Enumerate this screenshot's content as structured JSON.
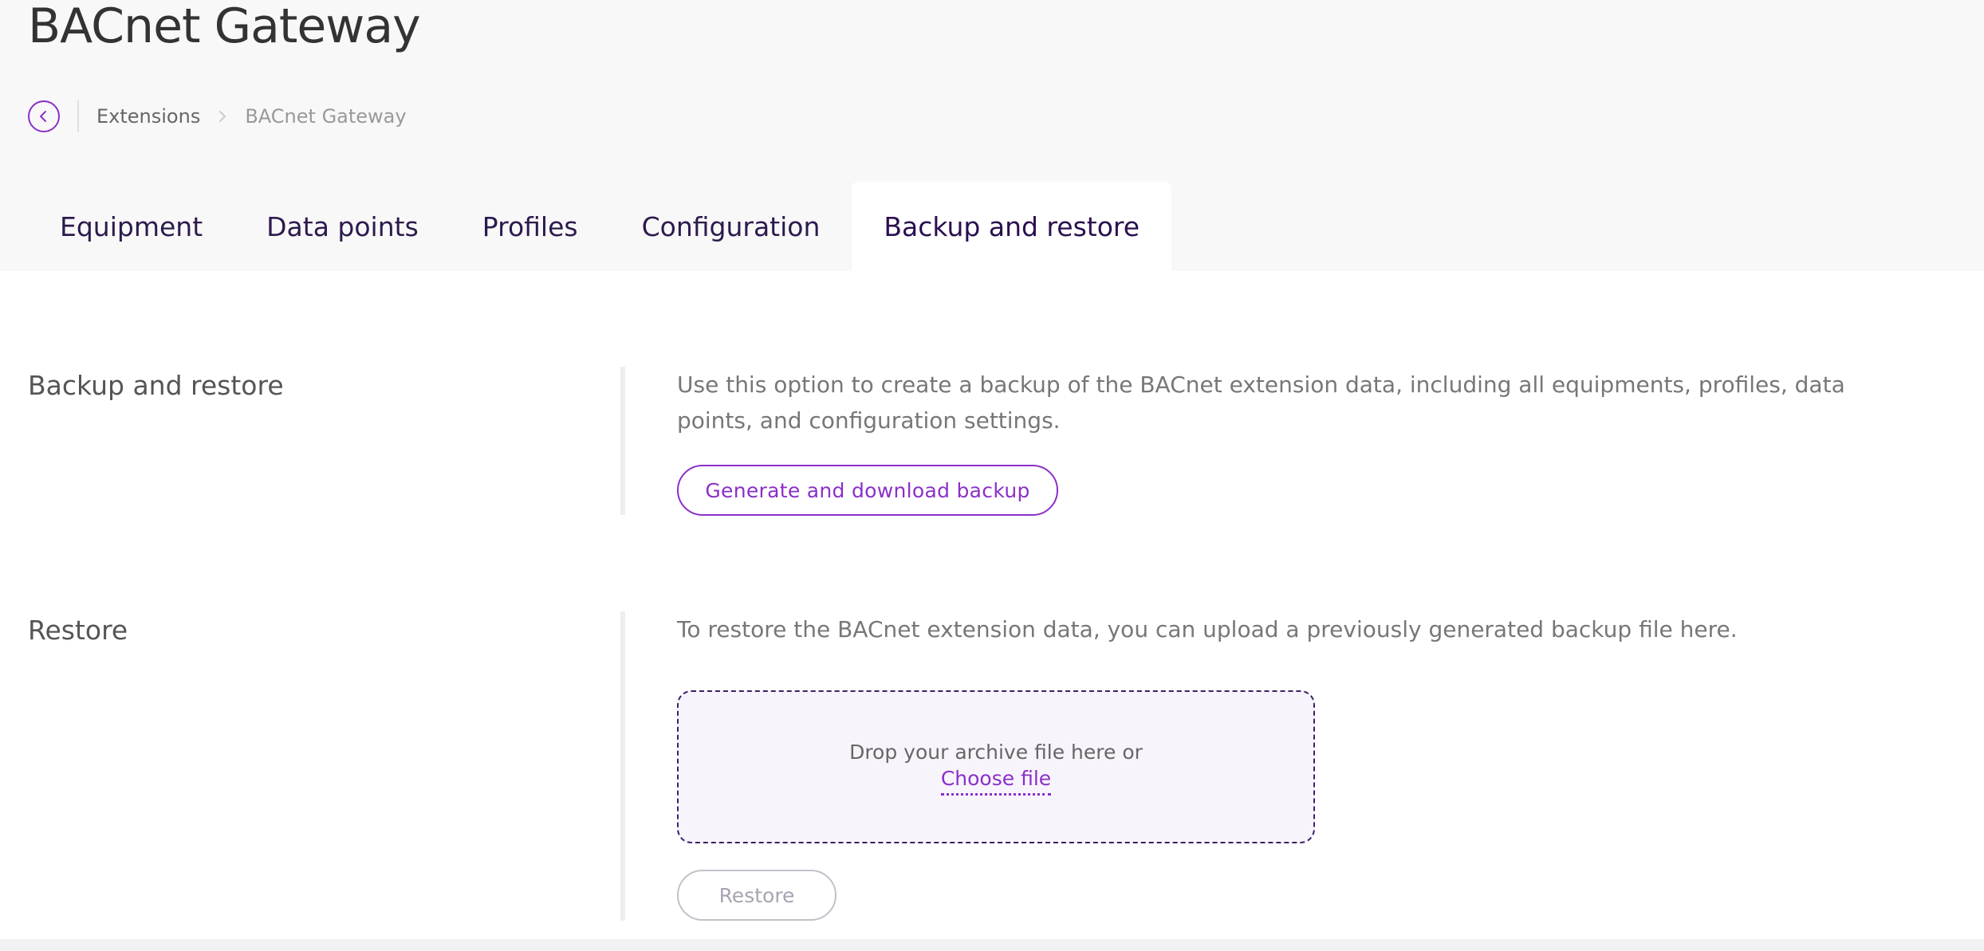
{
  "page": {
    "title": "BACnet Gateway"
  },
  "breadcrumb": {
    "back_icon": "chevron-left-icon",
    "items": [
      "Extensions",
      "BACnet Gateway"
    ]
  },
  "tabs": [
    {
      "label": "Equipment",
      "active": false
    },
    {
      "label": "Data points",
      "active": false
    },
    {
      "label": "Profiles",
      "active": false
    },
    {
      "label": "Configuration",
      "active": false
    },
    {
      "label": "Backup and restore",
      "active": true
    }
  ],
  "backup": {
    "label": "Backup and restore",
    "description": "Use this option to create a backup of the BACnet extension data, including all equipments, profiles, data points, and configuration settings.",
    "button_label": "Generate and download backup"
  },
  "restore": {
    "label": "Restore",
    "description": "To restore the BACnet extension data, you can upload a previously generated backup file here.",
    "dropzone_text": "Drop your archive file here or",
    "choose_file_label": "Choose file",
    "button_label": "Restore",
    "button_disabled": true
  },
  "colors": {
    "accent": "#8b2fc9",
    "dropzone_border": "#3d1f66",
    "dropzone_bg": "#f8f4fb",
    "header_bg": "#f8f8f8"
  }
}
